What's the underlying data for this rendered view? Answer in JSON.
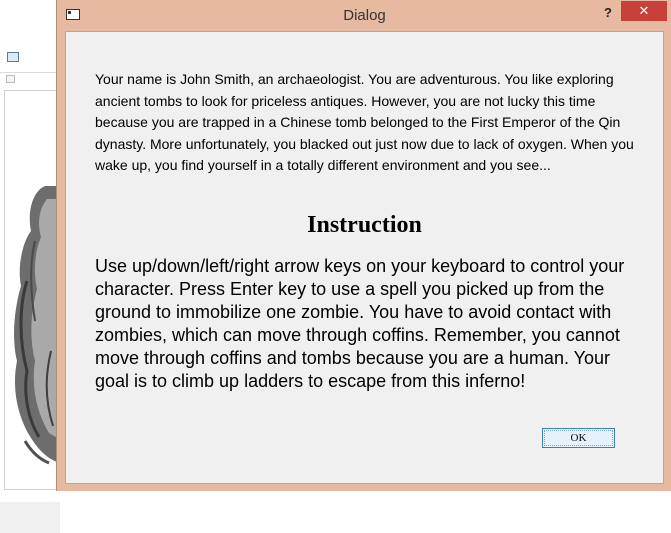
{
  "background_window": {
    "icons": [
      "window-icon",
      "toolbar-icon"
    ]
  },
  "dialog": {
    "title": "Dialog",
    "help_label": "?",
    "close_label": "✕",
    "story": "Your name is John Smith, an archaeologist. You are adventurous. You like exploring ancient tombs to look for priceless antiques. However, you are not lucky this time because you are trapped in a Chinese tomb belonged to the First Emperor of the Qin dynasty. More unfortunately, you blacked out just now due to lack of oxygen. When you wake up, you find yourself in a totally different environment and you see...",
    "heading": "Instruction",
    "instruction": "Use up/down/left/right arrow keys on your keyboard to control your character. Press Enter key to use a spell you picked up from the ground to immobilize one zombie. You have to avoid contact with zombies, which can move through coffins. Remember, you cannot move through coffins and tombs because you are a human. Your goal is to climb up ladders to escape from this inferno!",
    "ok_label": "OK"
  },
  "colors": {
    "frame": "#e7b9a1",
    "client": "#f0f0f0",
    "close": "#c7403a",
    "ok_border": "#3c7fb1"
  }
}
